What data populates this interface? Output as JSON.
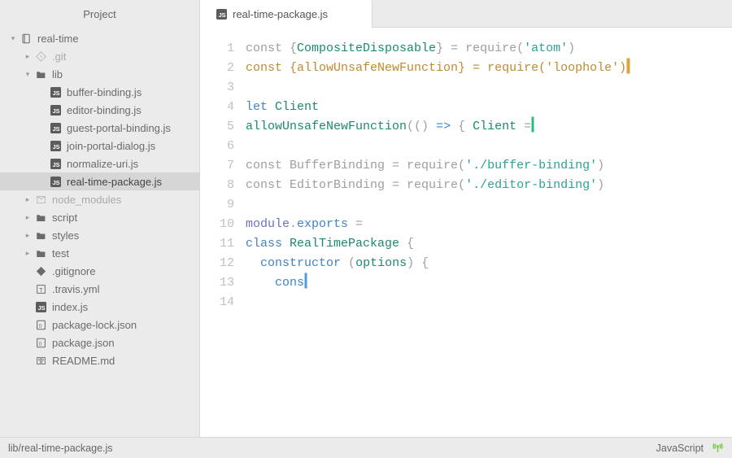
{
  "sidebar": {
    "title": "Project",
    "tree": [
      {
        "depth": 0,
        "chev": "expanded",
        "icon": "repo",
        "label": "real-time",
        "faded": false,
        "selected": false
      },
      {
        "depth": 1,
        "chev": "collapsed",
        "icon": "git",
        "label": ".git",
        "faded": true,
        "selected": false
      },
      {
        "depth": 1,
        "chev": "expanded",
        "icon": "folder",
        "label": "lib",
        "faded": false,
        "selected": false
      },
      {
        "depth": 2,
        "chev": "none",
        "icon": "js",
        "label": "buffer-binding.js",
        "faded": false,
        "selected": false
      },
      {
        "depth": 2,
        "chev": "none",
        "icon": "js",
        "label": "editor-binding.js",
        "faded": false,
        "selected": false
      },
      {
        "depth": 2,
        "chev": "none",
        "icon": "js",
        "label": "guest-portal-binding.js",
        "faded": false,
        "selected": false
      },
      {
        "depth": 2,
        "chev": "none",
        "icon": "js",
        "label": "join-portal-dialog.js",
        "faded": false,
        "selected": false
      },
      {
        "depth": 2,
        "chev": "none",
        "icon": "js",
        "label": "normalize-uri.js",
        "faded": false,
        "selected": false
      },
      {
        "depth": 2,
        "chev": "none",
        "icon": "js",
        "label": "real-time-package.js",
        "faded": false,
        "selected": true
      },
      {
        "depth": 1,
        "chev": "collapsed",
        "icon": "npm",
        "label": "node_modules",
        "faded": true,
        "selected": false
      },
      {
        "depth": 1,
        "chev": "collapsed",
        "icon": "folder",
        "label": "script",
        "faded": false,
        "selected": false
      },
      {
        "depth": 1,
        "chev": "collapsed",
        "icon": "folder",
        "label": "styles",
        "faded": false,
        "selected": false
      },
      {
        "depth": 1,
        "chev": "collapsed",
        "icon": "folder",
        "label": "test",
        "faded": false,
        "selected": false
      },
      {
        "depth": 1,
        "chev": "none",
        "icon": "gitign",
        "label": ".gitignore",
        "faded": false,
        "selected": false
      },
      {
        "depth": 1,
        "chev": "none",
        "icon": "travis",
        "label": ".travis.yml",
        "faded": false,
        "selected": false
      },
      {
        "depth": 1,
        "chev": "none",
        "icon": "js",
        "label": "index.js",
        "faded": false,
        "selected": false
      },
      {
        "depth": 1,
        "chev": "none",
        "icon": "json",
        "label": "package-lock.json",
        "faded": false,
        "selected": false
      },
      {
        "depth": 1,
        "chev": "none",
        "icon": "json",
        "label": "package.json",
        "faded": false,
        "selected": false
      },
      {
        "depth": 1,
        "chev": "none",
        "icon": "readme",
        "label": "README.md",
        "faded": false,
        "selected": false
      }
    ]
  },
  "tab": {
    "icon": "js",
    "title": "real-time-package.js"
  },
  "editor": {
    "line_count": 14,
    "lines": [
      [
        {
          "c": "plain",
          "t": "const "
        },
        {
          "c": "punct",
          "t": "{"
        },
        {
          "c": "id",
          "t": "CompositeDisposable"
        },
        {
          "c": "punct",
          "t": "} = "
        },
        {
          "c": "plain",
          "t": "require"
        },
        {
          "c": "punct",
          "t": "("
        },
        {
          "c": "str",
          "t": "'atom'"
        },
        {
          "c": "punct",
          "t": ")"
        }
      ],
      [
        {
          "c": "orange",
          "t": "const "
        },
        {
          "c": "orange",
          "t": "{allowUnsafeNewFunction}"
        },
        {
          "c": "orange",
          "t": " = require("
        },
        {
          "c": "orange",
          "t": "'loophole'"
        },
        {
          "c": "orange",
          "t": ")"
        },
        {
          "caret": "yellow"
        }
      ],
      [],
      [
        {
          "c": "key",
          "t": "let "
        },
        {
          "c": "id",
          "t": "Client"
        }
      ],
      [
        {
          "c": "id",
          "t": "allowUnsafeNewFunction"
        },
        {
          "c": "punct",
          "t": "(() "
        },
        {
          "c": "key",
          "t": "=>"
        },
        {
          "c": "punct",
          "t": " { "
        },
        {
          "c": "id",
          "t": "Client"
        },
        {
          "c": "punct",
          "t": " ="
        },
        {
          "caret": "green"
        }
      ],
      [],
      [
        {
          "c": "plain",
          "t": "const "
        },
        {
          "c": "plain",
          "t": "BufferBinding = require("
        },
        {
          "c": "str",
          "t": "'./buffer-binding'"
        },
        {
          "c": "plain",
          "t": ")"
        }
      ],
      [
        {
          "c": "plain",
          "t": "const "
        },
        {
          "c": "plain",
          "t": "EditorBinding = require("
        },
        {
          "c": "str",
          "t": "'./editor-binding'"
        },
        {
          "c": "plain",
          "t": ")"
        }
      ],
      [],
      [
        {
          "c": "purple",
          "t": "module"
        },
        {
          "c": "punct",
          "t": "."
        },
        {
          "c": "key",
          "t": "exports"
        },
        {
          "c": "punct",
          "t": " ="
        }
      ],
      [
        {
          "c": "key",
          "t": "class "
        },
        {
          "c": "id",
          "t": "RealTimePackage"
        },
        {
          "c": "punct",
          "t": " {"
        }
      ],
      [
        {
          "c": "punct",
          "t": "  "
        },
        {
          "c": "key",
          "t": "constructor "
        },
        {
          "c": "punct",
          "t": "("
        },
        {
          "c": "id",
          "t": "options"
        },
        {
          "c": "punct",
          "t": ") {"
        }
      ],
      [
        {
          "c": "punct",
          "t": "    "
        },
        {
          "c": "key",
          "t": "cons"
        },
        {
          "caret": "blue"
        }
      ],
      []
    ]
  },
  "status": {
    "path": "lib/real-time-package.js",
    "language": "JavaScript"
  }
}
